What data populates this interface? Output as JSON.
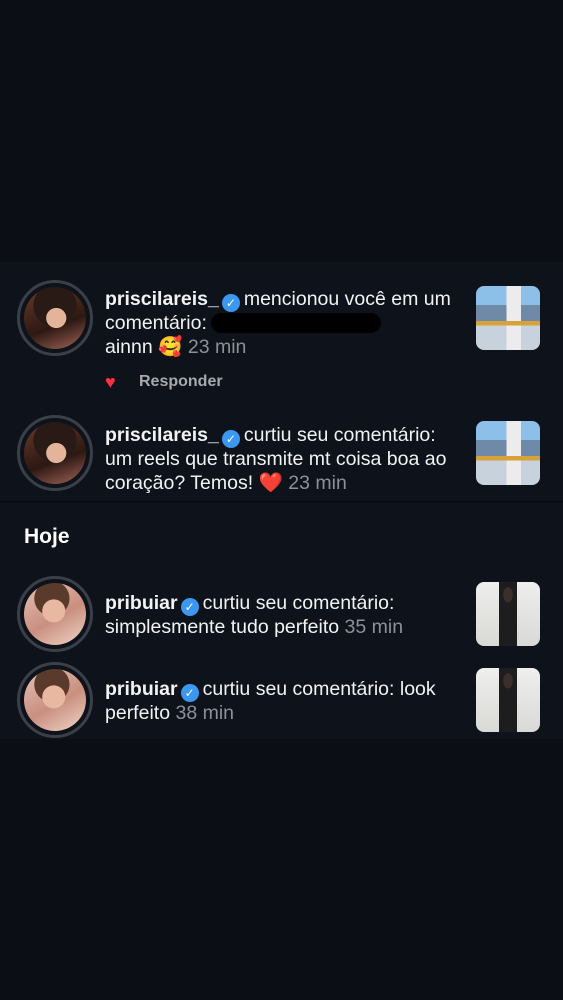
{
  "notifications_earlier": [
    {
      "username": "priscilareis_",
      "action": "mencionou você em um comentário:",
      "comment": "ainnn",
      "emoji": "🥰",
      "time": "23 min",
      "avatar": "priscilareis-avatar",
      "thumbnail": "city-reel-thumbnail",
      "reply_label": "Responder"
    },
    {
      "username": "priscilareis_",
      "action": "curtiu seu comentário:",
      "comment": "um reels que transmite mt coisa boa ao coração? Temos!",
      "emoji": "❤️",
      "time": "23 min",
      "avatar": "priscilareis-avatar",
      "thumbnail": "city-reel-thumbnail"
    }
  ],
  "section_today": "Hoje",
  "notifications_today": [
    {
      "username": "pribuiar",
      "action": "curtiu seu comentário:",
      "comment": "simplesmente tudo perfeito",
      "time": "35 min",
      "avatar": "pribuiar-avatar",
      "thumbnail": "look-photo-thumbnail"
    },
    {
      "username": "pribuiar",
      "action": "curtiu seu comentário:",
      "comment": "look perfeito",
      "time": "38 min",
      "avatar": "pribuiar-avatar",
      "thumbnail": "look-photo-thumbnail"
    }
  ],
  "colors": {
    "background": "#0b0e14",
    "panel": "#0e121a",
    "verified": "#3b97f0",
    "heart": "#ff3040",
    "muted_text": "#8e9097"
  },
  "icons": {
    "verified": "verified-badge-icon",
    "like": "heart-icon"
  }
}
